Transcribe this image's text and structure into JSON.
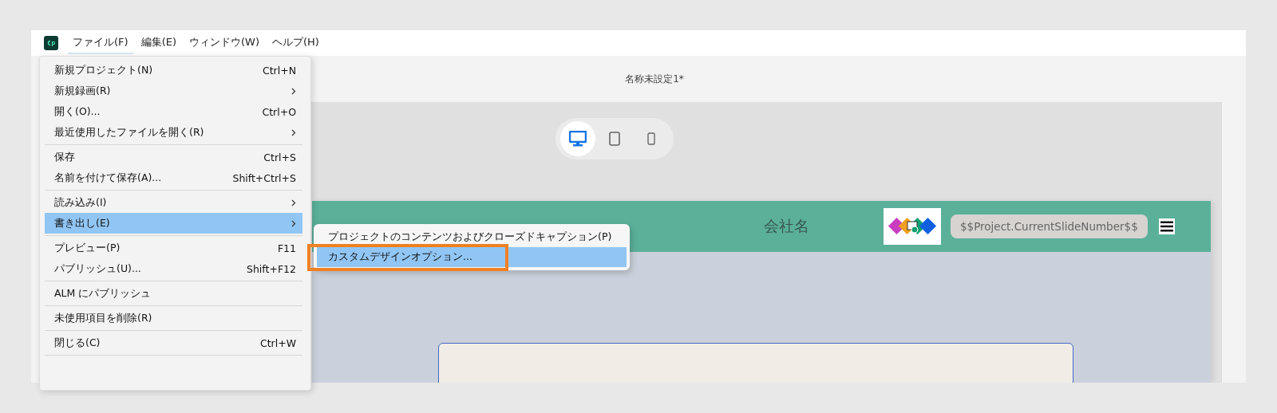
{
  "menubar": {
    "items": [
      {
        "label": "ファイル(F)",
        "selected": true
      },
      {
        "label": "編集(E)",
        "selected": false
      },
      {
        "label": "ウィンドウ(W)",
        "selected": false
      },
      {
        "label": "ヘルプ(H)",
        "selected": false
      }
    ]
  },
  "document": {
    "title": "名称未設定1*"
  },
  "device_toggle": [
    {
      "kind": "desktop",
      "selected": true
    },
    {
      "kind": "tablet",
      "selected": false
    },
    {
      "kind": "phone",
      "selected": false
    }
  ],
  "slide": {
    "header": {
      "company": "会社名",
      "slide_number": "$$Project.CurrentSlideNumber$$"
    }
  },
  "file_menu": {
    "groups": [
      [
        {
          "label": "新規プロジェクト(N)",
          "shortcut": "Ctrl+N",
          "submenu": false,
          "selected": false
        },
        {
          "label": "新規録画(R)",
          "submenu": true,
          "selected": false
        },
        {
          "label": "開く(O)...",
          "shortcut": "Ctrl+O",
          "submenu": false,
          "selected": false
        },
        {
          "label": "最近使用したファイルを開く(R)",
          "submenu": true,
          "selected": false
        }
      ],
      [
        {
          "label": "保存",
          "shortcut": "Ctrl+S",
          "submenu": false,
          "selected": false
        },
        {
          "label": "名前を付けて保存(A)...",
          "shortcut": "Shift+Ctrl+S",
          "submenu": false,
          "selected": false
        }
      ],
      [
        {
          "label": "読み込み(I)",
          "submenu": true,
          "selected": false
        },
        {
          "label": "書き出し(E)",
          "submenu": true,
          "selected": true
        }
      ],
      [
        {
          "label": "プレビュー(P)",
          "shortcut": "F11",
          "submenu": false,
          "selected": false
        },
        {
          "label": "パブリッシュ(U)...",
          "shortcut": "Shift+F12",
          "submenu": false,
          "selected": false
        }
      ],
      [
        {
          "label": "ALM にパブリッシュ",
          "submenu": false,
          "selected": false
        }
      ],
      [
        {
          "label": "未使用項目を削除(R)",
          "submenu": false,
          "selected": false
        }
      ],
      [
        {
          "label": "閉じる(C)",
          "shortcut": "Ctrl+W",
          "submenu": false,
          "selected": false
        }
      ]
    ]
  },
  "export_submenu": {
    "items": [
      {
        "label": "プロジェクトのコンテンツおよびクローズドキャプション(P)",
        "selected": false,
        "highlighted": false
      },
      {
        "label": "カスタムデザインオプション...",
        "selected": true,
        "highlighted": true
      }
    ]
  }
}
